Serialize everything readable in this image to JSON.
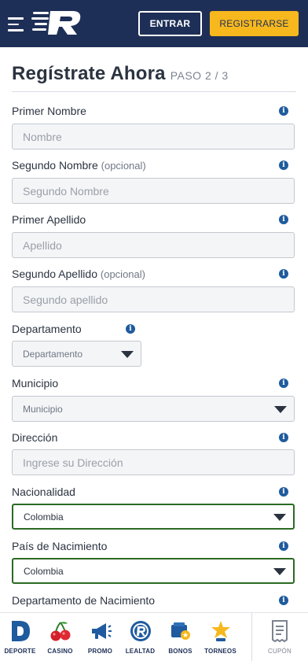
{
  "header": {
    "entrar_label": "ENTRAR",
    "registrarse_label": "REGISTRARSE",
    "bg_color": "#1e2f57",
    "accent_color": "#f7b81e"
  },
  "form": {
    "title": "Regístrate Ahora",
    "step": "PASO 2 / 3",
    "fields": {
      "primer_nombre": {
        "label": "Primer Nombre",
        "placeholder": "Nombre"
      },
      "segundo_nombre": {
        "label": "Segundo Nombre",
        "optional": "(opcional)",
        "placeholder": "Segundo Nombre"
      },
      "primer_apellido": {
        "label": "Primer Apellido",
        "placeholder": "Apellido"
      },
      "segundo_apellido": {
        "label": "Segundo Apellido",
        "optional": "(opcional)",
        "placeholder": "Segundo apellido"
      },
      "departamento": {
        "label": "Departamento",
        "selected": "Departamento"
      },
      "municipio": {
        "label": "Municipio",
        "selected": "Municipio"
      },
      "direccion": {
        "label": "Dirección",
        "placeholder": "Ingrese su Dirección"
      },
      "nacionalidad": {
        "label": "Nacionalidad",
        "selected": "Colombia"
      },
      "pais_nacimiento": {
        "label": "País de Nacimiento",
        "selected": "Colombia"
      },
      "departamento_nacimiento": {
        "label": "Departamento de Nacimiento"
      }
    },
    "info_icon": "info-icon",
    "valid_border_color": "#2b6a24"
  },
  "bottom_nav": {
    "items": [
      {
        "label": "DEPORTE",
        "icon": "sports-d-icon"
      },
      {
        "label": "CASINO",
        "icon": "cherries-icon"
      },
      {
        "label": "PROMO",
        "icon": "megaphone-icon"
      },
      {
        "label": "LEALTAD",
        "icon": "loyalty-badge-icon"
      },
      {
        "label": "BONOS",
        "icon": "bonus-icon"
      },
      {
        "label": "TORNEOS",
        "icon": "trophy-star-icon"
      }
    ],
    "cupon": {
      "label": "CUPÓN",
      "icon": "coupon-ticket-icon"
    }
  }
}
